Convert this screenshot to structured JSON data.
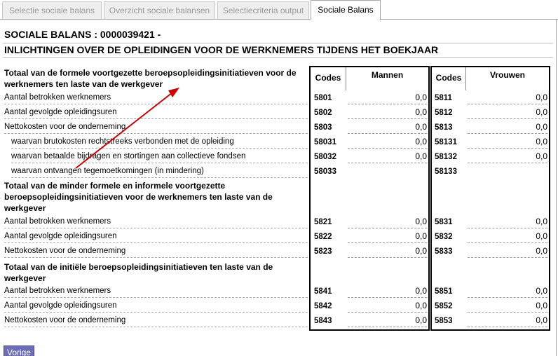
{
  "tabs": [
    {
      "label": "Selectie sociale balans"
    },
    {
      "label": "Overzicht sociale balansen"
    },
    {
      "label": "Selectiecriteria output"
    },
    {
      "label": "Sociale Balans"
    }
  ],
  "page": {
    "title": "SOCIALE BALANS : 0000039421 -",
    "subtitle": "INLICHTINGEN OVER DE OPLEIDINGEN VOOR DE WERKNEMERS TIJDENS HET BOEKJAAR"
  },
  "table": {
    "codes_header": "Codes",
    "mannen_header": "Mannen",
    "vrouwen_header": "Vrouwen",
    "sections": [
      {
        "title": "Totaal van de formele voortgezette beroepsopleidingsinitiatieven voor de werknemers ten laste van de werkgever",
        "rows": [
          {
            "label": "Aantal betrokken werknemers",
            "code_m": "5801",
            "val_m": "0,0",
            "code_v": "5811",
            "val_v": "0,0"
          },
          {
            "label": "Aantal gevolgde opleidingsuren",
            "code_m": "5802",
            "val_m": "0,0",
            "code_v": "5812",
            "val_v": "0,0"
          },
          {
            "label": "Nettokosten voor de onderneming",
            "code_m": "5803",
            "val_m": "0,0",
            "code_v": "5813",
            "val_v": "0,0"
          },
          {
            "label": "waarvan brutokosten rechtstreeks verbonden met de opleiding",
            "code_m": "58031",
            "val_m": "0,0",
            "code_v": "58131",
            "val_v": "0,0"
          },
          {
            "label": "waarvan betaalde bijdragen en stortingen aan collectieve fondsen",
            "code_m": "58032",
            "val_m": "0,0",
            "code_v": "58132",
            "val_v": "0,0"
          },
          {
            "label": "waarvan ontvangen tegemoetkomingen (in mindering)",
            "code_m": "58033",
            "val_m": "",
            "code_v": "58133",
            "val_v": ""
          }
        ]
      },
      {
        "title": "Totaal van de minder formele en informele voortgezette beroepsopleidingsinitiatieven voor de werknemers ten laste van de werkgever",
        "rows": [
          {
            "label": "Aantal betrokken werknemers",
            "code_m": "5821",
            "val_m": "0,0",
            "code_v": "5831",
            "val_v": "0,0"
          },
          {
            "label": "Aantal gevolgde opleidingsuren",
            "code_m": "5822",
            "val_m": "0,0",
            "code_v": "5832",
            "val_v": "0,0"
          },
          {
            "label": "Nettokosten voor de onderneming",
            "code_m": "5823",
            "val_m": "0,0",
            "code_v": "5833",
            "val_v": "0,0"
          }
        ]
      },
      {
        "title": "Totaal van de initiële beroepsopleidingsinitiatieven ten laste van de werkgever",
        "rows": [
          {
            "label": "Aantal betrokken werknemers",
            "code_m": "5841",
            "val_m": "0,0",
            "code_v": "5851",
            "val_v": "0,0"
          },
          {
            "label": "Aantal gevolgde opleidingsuren",
            "code_m": "5842",
            "val_m": "0,0",
            "code_v": "5852",
            "val_v": "0,0"
          },
          {
            "label": "Nettokosten voor de onderneming",
            "code_m": "5843",
            "val_m": "0,0",
            "code_v": "5853",
            "val_v": "0,0"
          }
        ]
      }
    ]
  },
  "buttons": {
    "previous": "Vorige"
  },
  "annotation": {
    "arrow_color": "#cc0000"
  }
}
